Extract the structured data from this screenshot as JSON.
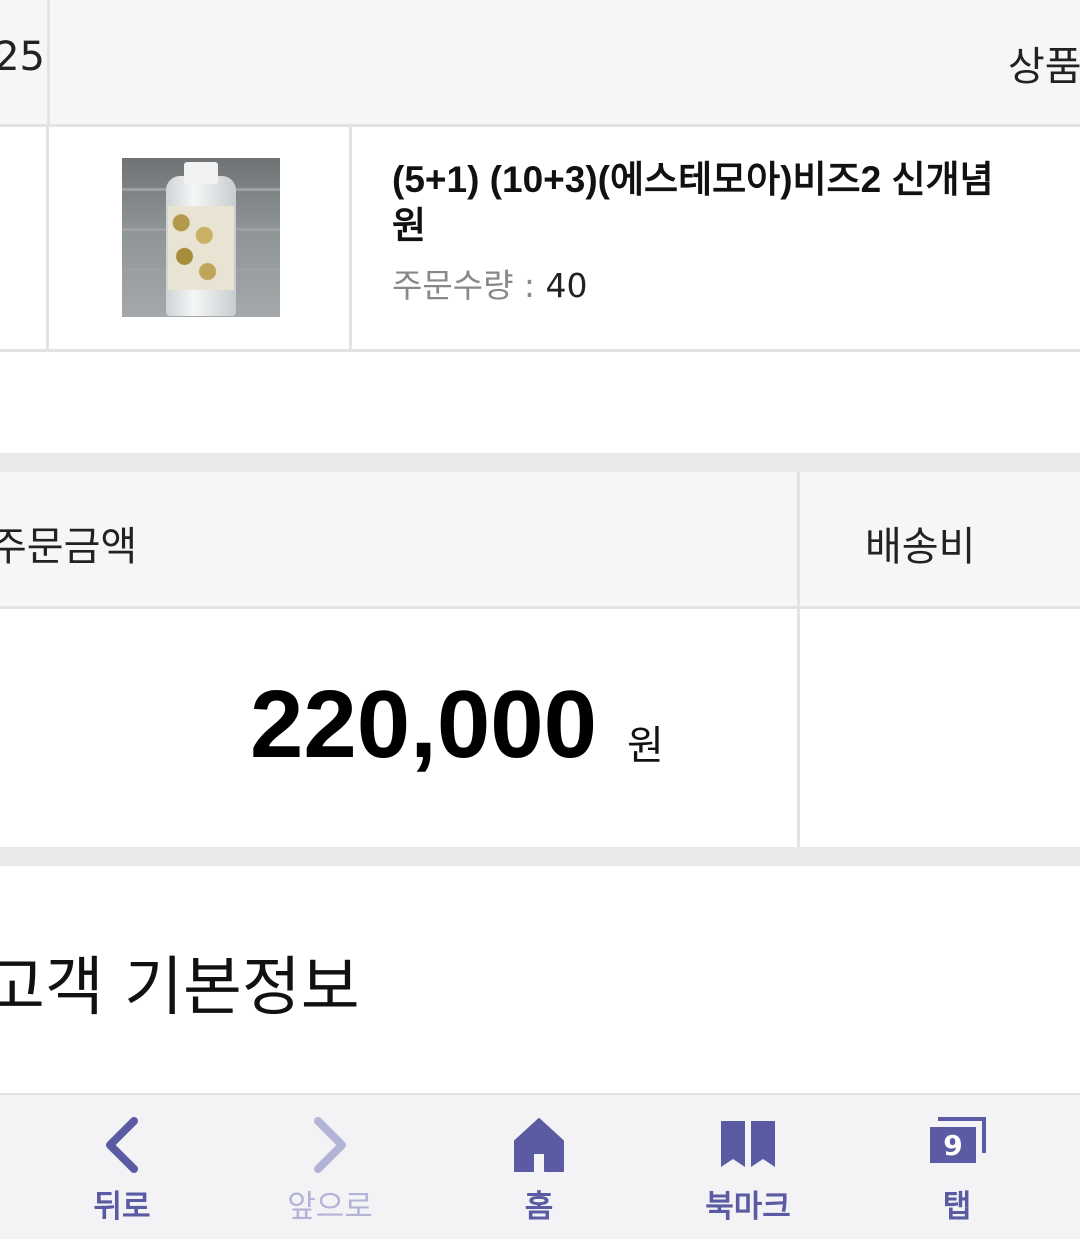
{
  "order_table": {
    "date_partial": "25",
    "product_header_partial": "상품"
  },
  "product": {
    "name_line1": "(5+1) (10+3)(에스테모아)비즈2 신개념",
    "name_line2": "원",
    "qty_label": "주문수량 : ",
    "qty_value": "40"
  },
  "summary": {
    "amount_label": "주문금액",
    "shipping_label": "배송비",
    "amount": "220,000",
    "amount_unit": "원"
  },
  "customer_section": {
    "title": "고객 기본정보"
  },
  "toolbar": {
    "back": "뒤로",
    "forward": "앞으로",
    "home": "홈",
    "bookmark": "북마크",
    "tabs": "탭",
    "tab_count": "9",
    "accent_color": "#5a5ba3",
    "disabled_color": "#b3b3d6"
  },
  "icons": [
    "chevron-left-icon",
    "chevron-right-icon",
    "home-icon",
    "bookmark-icon",
    "tabs-icon"
  ]
}
